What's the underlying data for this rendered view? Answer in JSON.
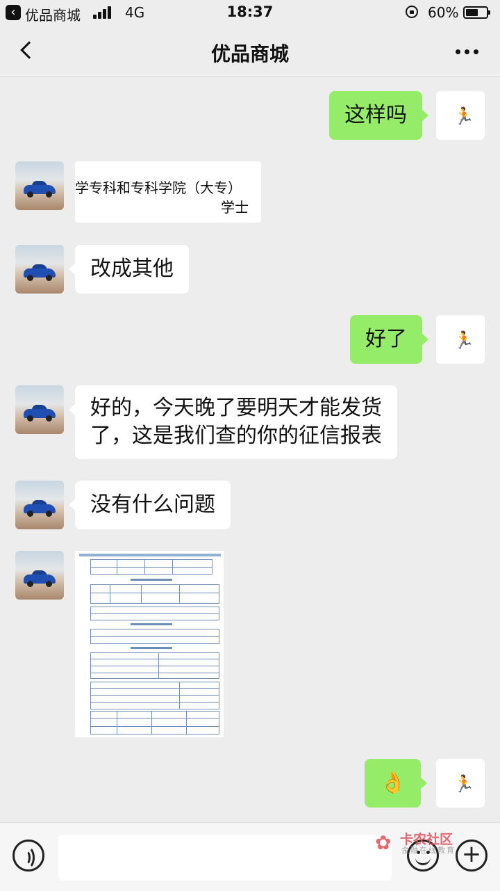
{
  "status_bar": {
    "app_name": "优品商城",
    "network": "4G",
    "time": "18:37",
    "battery_pct": "60%",
    "battery_level": 0.6
  },
  "nav": {
    "title": "优品商城"
  },
  "messages": [
    {
      "side": "out",
      "type": "text",
      "text": "这样吗"
    },
    {
      "side": "in",
      "type": "image",
      "crop_line1": "学专科和专科学院（大专）",
      "crop_line2": "学士"
    },
    {
      "side": "in",
      "type": "text",
      "text": "改成其他"
    },
    {
      "side": "out",
      "type": "text",
      "text": "好了"
    },
    {
      "side": "in",
      "type": "text",
      "line1": "好的，今天晚了要明天才能发货",
      "line2": "了，这是我们查的你的征信报表"
    },
    {
      "side": "in",
      "type": "text",
      "text": "没有什么问题"
    },
    {
      "side": "in",
      "type": "image",
      "description_icon": "report-image"
    },
    {
      "side": "out",
      "type": "text",
      "text": "👌"
    }
  ],
  "watermark": {
    "text": "卡农社区",
    "sub": "金融在线教育"
  },
  "icons": {
    "back": "chevron-left-icon",
    "more": "more-dots-icon",
    "voice": "voice-icon",
    "emoji": "emoji-icon",
    "plus": "plus-icon"
  },
  "colors": {
    "outgoing_bubble": "#95ec69",
    "incoming_bubble": "#ffffff",
    "background": "#ededed"
  }
}
